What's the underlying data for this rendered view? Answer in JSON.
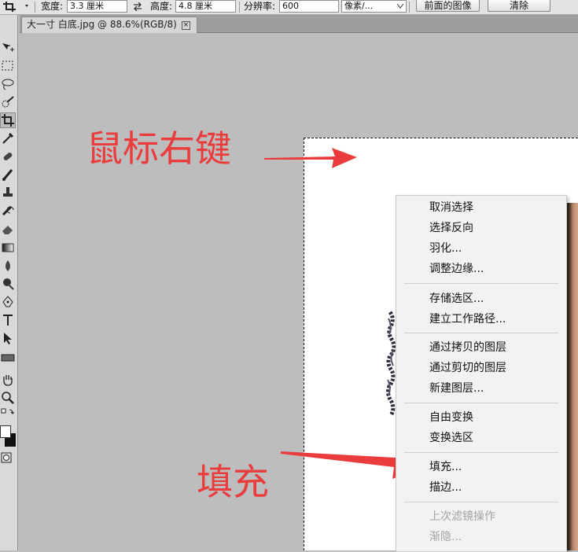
{
  "options_bar": {
    "width_label": "宽度:",
    "width_value": "3.3 厘米",
    "height_label": "高度:",
    "height_value": "4.8 厘米",
    "resolution_label": "分辨率:",
    "resolution_value": "600",
    "unit_select": "像素/...",
    "front_image_button": "前面的图像",
    "clear_button": "清除"
  },
  "document_tab": {
    "title": "大一寸 白底.jpg @ 88.6%(RGB/8)",
    "close": "×"
  },
  "annotations": {
    "right_click": "鼠标右键",
    "fill": "填充"
  },
  "context_menu": {
    "groups": [
      [
        "取消选择",
        "选择反向",
        "羽化...",
        "调整边缘..."
      ],
      [
        "存储选区...",
        "建立工作路径..."
      ],
      [
        "通过拷贝的图层",
        "通过剪切的图层",
        "新建图层..."
      ],
      [
        "自由变换",
        "变换选区"
      ],
      [
        "填充...",
        "描边..."
      ],
      [
        "上次滤镜操作",
        "渐隐..."
      ]
    ]
  },
  "colors": {
    "annotation_red": "#ea3c3c",
    "workspace_gray": "#bdbdbd"
  },
  "toolbox_icons": [
    "move-icon",
    "marquee-icon",
    "lasso-icon",
    "quick-select-icon",
    "crop-icon",
    "eyedropper-icon",
    "healing-brush-icon",
    "brush-icon",
    "clone-stamp-icon",
    "history-brush-icon",
    "eraser-icon",
    "gradient-icon",
    "blur-icon",
    "dodge-icon",
    "pen-icon",
    "type-icon",
    "path-select-icon",
    "shape-icon",
    "hand-icon",
    "zoom-icon"
  ]
}
